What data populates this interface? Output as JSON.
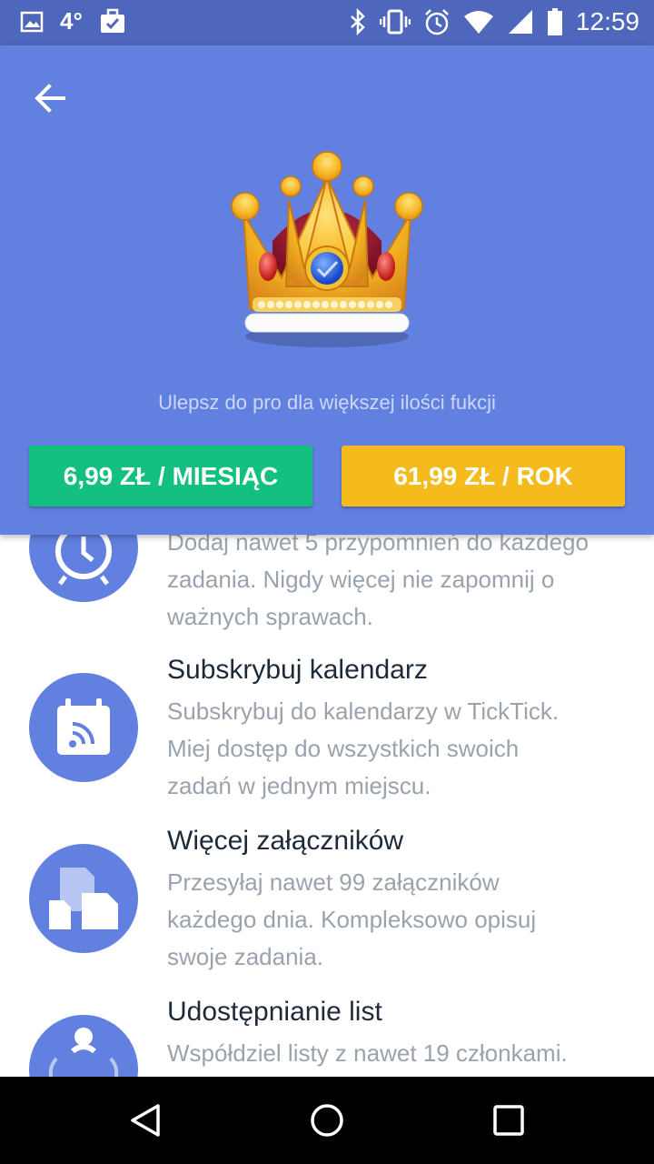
{
  "status_bar": {
    "temperature": "4°",
    "time": "12:59",
    "icons": [
      "image-icon",
      "briefcase-check-icon",
      "bluetooth-icon",
      "vibrate-icon",
      "alarm-icon",
      "wifi-icon",
      "signal-icon",
      "battery-icon"
    ]
  },
  "header": {
    "tagline": "Ulepsz do pro dla większej ilości fukcji",
    "monthly_button": "6,99 ZŁ / MIESIĄC",
    "yearly_button": "61,99 ZŁ / ROK",
    "colors": {
      "header_bg": "#6180e0",
      "month_button": "#14c080",
      "year_button": "#f5bb1d"
    }
  },
  "features": [
    {
      "icon": "alarm-clock-icon",
      "title": "",
      "lines": [
        "Dodaj nawet 5 przypomnień do każdego",
        "zadania. Nigdy więcej nie zapomnij o",
        "ważnych sprawach."
      ]
    },
    {
      "icon": "calendar-subscribe-icon",
      "title": "Subskrybuj kalendarz",
      "lines": [
        "Subskrybuj do kalendarzy w TickTick.",
        "Miej dostęp do wszystkich swoich",
        "zadań w jednym miejscu."
      ]
    },
    {
      "icon": "attachments-icon",
      "title": "Więcej załączników",
      "lines": [
        "Przesyłaj nawet 99 załączników",
        "każdego dnia. Kompleksowo opisuj",
        "swoje zadania."
      ]
    },
    {
      "icon": "share-lists-icon",
      "title": "Udostępnianie list",
      "lines": [
        "Współdziel listy z nawet 19 członkami."
      ]
    }
  ]
}
